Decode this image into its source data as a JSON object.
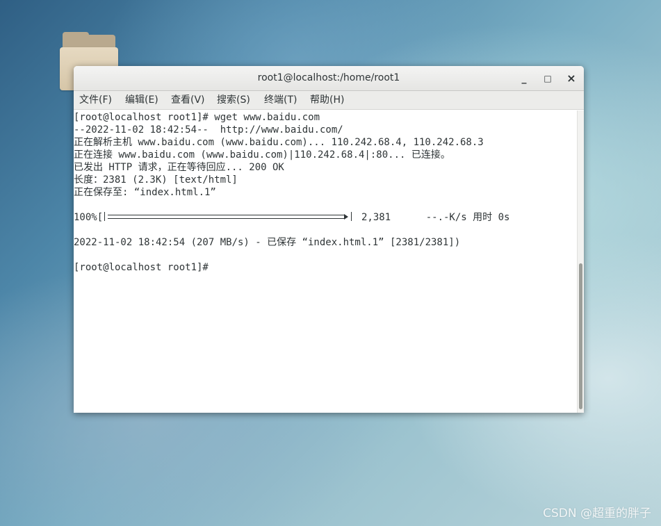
{
  "desktop": {
    "folder_icon": "folder-icon",
    "watermark": "CSDN @超重的胖子"
  },
  "window": {
    "title": "root1@localhost:/home/root1",
    "controls": {
      "minimize": "_",
      "maximize": "□",
      "close": "×"
    }
  },
  "menu": [
    "文件(F)",
    "编辑(E)",
    "查看(V)",
    "搜索(S)",
    "终端(T)",
    "帮助(H)"
  ],
  "terminal": {
    "lines": [
      "[root@localhost root1]# wget www.baidu.com",
      "--2022-11-02 18:42:54--  http://www.baidu.com/",
      "正在解析主机 www.baidu.com (www.baidu.com)... 110.242.68.4, 110.242.68.3",
      "正在连接 www.baidu.com (www.baidu.com)|110.242.68.4|:80... 已连接。",
      "已发出 HTTP 请求，正在等待回应... 200 OK",
      "长度：2381 (2.3K) [text/html]",
      "正在保存至: “index.html.1”",
      "",
      "",
      "",
      "2022-11-02 18:42:54 (207 MB/s) - 已保存 “index.html.1” [2381/2381])",
      "",
      "[root@localhost root1]#"
    ],
    "progress": {
      "percent_label": "100%[",
      "fraction": 1.0,
      "rest": "2,381      --.-K/s 用时 0s"
    }
  },
  "colors": {
    "terminal_bg": "#ffffff",
    "terminal_fg": "#2e3436",
    "titlebar_bg": "#e8e8e7",
    "scroll_thumb": "#9b9d98"
  }
}
